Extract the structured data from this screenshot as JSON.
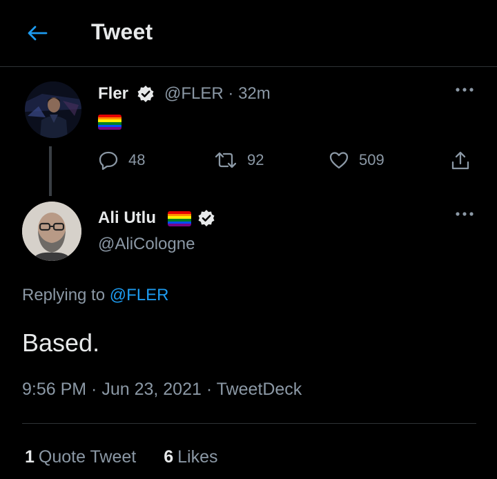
{
  "header": {
    "title": "Tweet"
  },
  "parent_tweet": {
    "name": "Fler",
    "handle": "@FLER",
    "separator": "·",
    "time": "32m",
    "content_emoji": "rainbow-flag",
    "actions": {
      "replies": "48",
      "retweets": "92",
      "likes": "509"
    }
  },
  "main_tweet": {
    "name": "Ali Utlu",
    "handle": "@AliCologne",
    "replying_prefix": "Replying to",
    "replying_to": "@FLER",
    "text": "Based.",
    "meta": "9:56 PM · Jun 23, 2021 · TweetDeck"
  },
  "stats": {
    "quote_count": "1",
    "quote_label": "Quote Tweet",
    "likes_count": "6",
    "likes_label": "Likes"
  },
  "colors": {
    "background": "#000000",
    "text_primary": "#e7e9ea",
    "text_secondary": "#8b98a5",
    "accent": "#1d9bf0",
    "divider": "#2f3336"
  }
}
